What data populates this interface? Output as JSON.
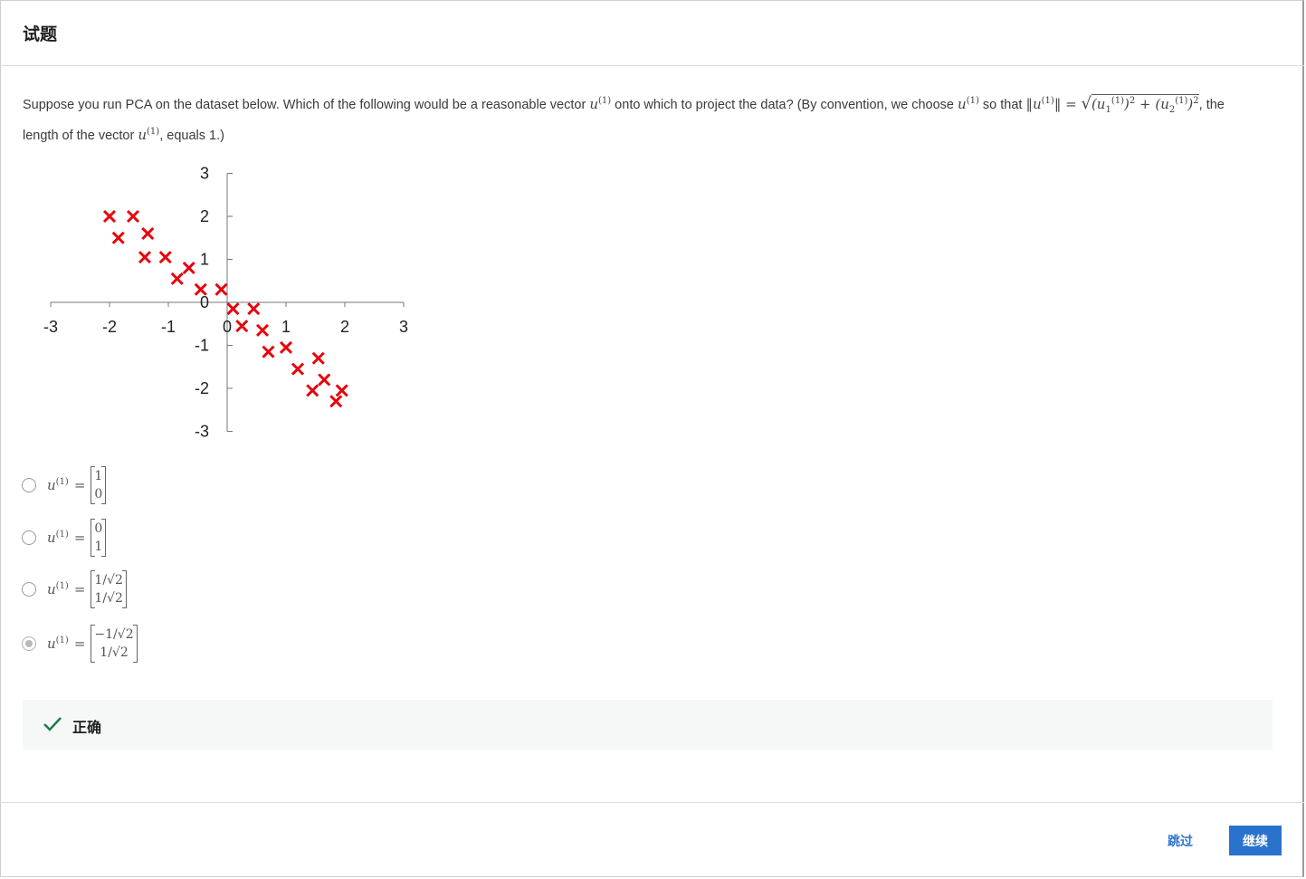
{
  "header": {
    "title": "试题"
  },
  "question": {
    "part1": "Suppose you run PCA on the dataset below. Which of the following would be a reasonable vector ",
    "part2": " onto which to project the data? (By convention, we choose ",
    "part3": " so that ",
    "part4": ", the",
    "part5": "length of the vector ",
    "part6": ", equals 1.)"
  },
  "chart_data": {
    "type": "scatter",
    "marker": "x",
    "color": "#e8000b",
    "xlim": [
      -3,
      3
    ],
    "ylim": [
      -3,
      3
    ],
    "x_ticks": [
      "-3",
      "-2",
      "-1",
      "0",
      "1",
      "2",
      "3"
    ],
    "y_ticks": [
      "3",
      "2",
      "1",
      "0",
      "-1",
      "-2",
      "-3"
    ],
    "points": [
      {
        "x": -2.0,
        "y": 2.0
      },
      {
        "x": -1.6,
        "y": 2.0
      },
      {
        "x": -1.85,
        "y": 1.5
      },
      {
        "x": -1.35,
        "y": 1.6
      },
      {
        "x": -1.4,
        "y": 1.05
      },
      {
        "x": -1.05,
        "y": 1.05
      },
      {
        "x": -0.65,
        "y": 0.8
      },
      {
        "x": -0.85,
        "y": 0.55
      },
      {
        "x": -0.45,
        "y": 0.3
      },
      {
        "x": -0.1,
        "y": 0.3
      },
      {
        "x": 0.1,
        "y": -0.15
      },
      {
        "x": 0.45,
        "y": -0.15
      },
      {
        "x": 0.25,
        "y": -0.55
      },
      {
        "x": 0.6,
        "y": -0.65
      },
      {
        "x": 0.7,
        "y": -1.15
      },
      {
        "x": 1.0,
        "y": -1.05
      },
      {
        "x": 1.2,
        "y": -1.55
      },
      {
        "x": 1.55,
        "y": -1.3
      },
      {
        "x": 1.65,
        "y": -1.8
      },
      {
        "x": 1.45,
        "y": -2.05
      },
      {
        "x": 1.95,
        "y": -2.05
      },
      {
        "x": 1.85,
        "y": -2.3
      }
    ]
  },
  "options": [
    {
      "rows": [
        "1",
        "0"
      ],
      "selected": false
    },
    {
      "rows": [
        "0",
        "1"
      ],
      "selected": false
    },
    {
      "rows": [
        "1/√2",
        "1/√2"
      ],
      "selected": false
    },
    {
      "rows": [
        "−1/√2",
        "1/√2"
      ],
      "selected": true
    }
  ],
  "feedback": {
    "text": "正确",
    "icon": "check-icon",
    "color": "#1f7a4d"
  },
  "footer": {
    "skip_label": "跳过",
    "continue_label": "继续",
    "accent": "#2a73cc"
  }
}
